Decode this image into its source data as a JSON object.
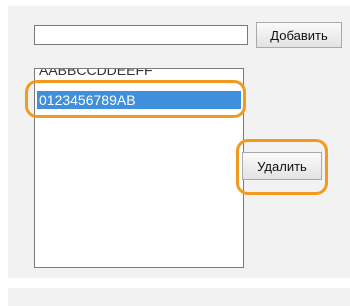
{
  "form": {
    "input_value": "",
    "add_label": "Добавить",
    "delete_label": "Удалить"
  },
  "list": {
    "items": [
      {
        "label": "AABBCCDDEEFF",
        "selected": false
      },
      {
        "label": "0123456789AB",
        "selected": true
      }
    ]
  },
  "colors": {
    "highlight": "#f39a1e",
    "selection": "#3f8fdc",
    "panel": "#f2f2f2"
  }
}
